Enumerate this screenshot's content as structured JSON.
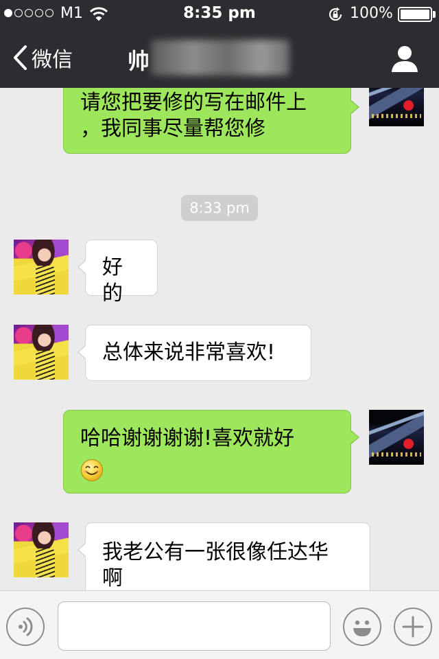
{
  "status_bar": {
    "carrier": "M1",
    "signal_bars_filled": 1,
    "signal_bars_total": 5,
    "time": "8:35 pm",
    "battery": "100%",
    "icons": [
      "signal-dots-icon",
      "wifi-icon",
      "rotation-lock-icon",
      "battery-icon"
    ]
  },
  "nav": {
    "back_label": "微信",
    "title": "帅",
    "title_obscured": true,
    "icons": [
      "chevron-left-icon",
      "person-icon"
    ]
  },
  "chat": {
    "messages": [
      {
        "side": "out",
        "text": "请您把要修的写在邮件上\n，我同事尽量帮您修"
      },
      {
        "type": "timestamp",
        "text": "8:33 pm"
      },
      {
        "side": "in",
        "text": "好的"
      },
      {
        "side": "in",
        "text": "总体来说非常喜欢!"
      },
      {
        "side": "out",
        "text": "哈哈谢谢谢谢!喜欢就好",
        "emoji": "smiley-face-icon"
      },
      {
        "side": "in",
        "text": "我老公有一张很像任达华\n啊"
      }
    ]
  },
  "input_bar": {
    "placeholder": "",
    "icons": [
      "voice-icon",
      "emoji-icon",
      "plus-icon"
    ]
  },
  "colors": {
    "nav_background": "#2d2d31",
    "chat_background": "#ebebeb",
    "outgoing_bubble": "#9ee65b",
    "incoming_bubble": "#ffffff",
    "timestamp_pill": "#cfcfcf",
    "input_bar": "#f4f4f6"
  }
}
